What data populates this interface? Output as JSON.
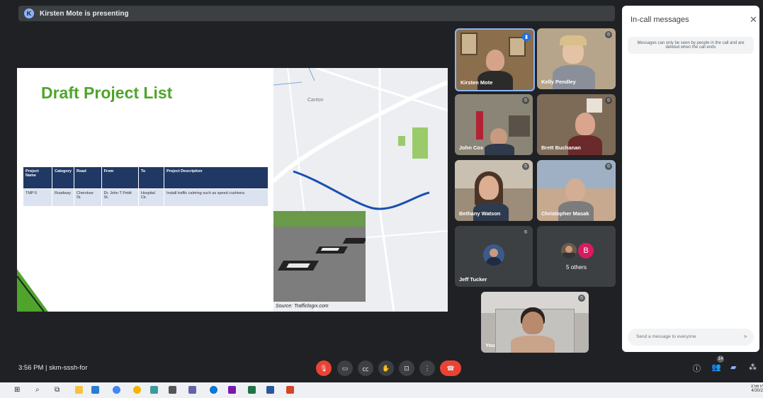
{
  "presenter": {
    "initial": "K",
    "text": "Kirsten Mote is presenting"
  },
  "slide": {
    "title": "Draft Project List",
    "table_headers": [
      "Project Name",
      "Category",
      "Road",
      "From",
      "To",
      "Project Description"
    ],
    "table_rows": [
      [
        "TMP 6",
        "Roadway",
        "Cherokee St.",
        "Dr. John T Pettit St.",
        "Hospital Cir.",
        "Install traffic calming such as speed cushions."
      ]
    ],
    "map_label": "Canton",
    "source": "Source: Trafficlogix.com"
  },
  "participants": [
    {
      "name": "Kirsten Mote",
      "mic": "speaking",
      "bg": "#8b6e4c"
    },
    {
      "name": "Kelly Pendley",
      "mic": "muted",
      "bg": "#b6a58a"
    },
    {
      "name": "John Cox",
      "mic": "muted",
      "bg": "#8a8576"
    },
    {
      "name": "Brett Buchanan",
      "mic": "muted",
      "bg": "#7d6b58"
    },
    {
      "name": "Bethany Watson",
      "mic": "muted",
      "bg": "#9c8c7a"
    },
    {
      "name": "Christopher Masak",
      "mic": "muted",
      "bg": "#9fb0c4"
    },
    {
      "name": "Jeff Tucker",
      "mic": "muted",
      "bg": "#3c4043"
    },
    {
      "name": "5 others",
      "mic": "",
      "bg": "#3c4043",
      "avatar_letter": "B"
    },
    {
      "name": "You",
      "mic": "muted",
      "bg": "#b8b5b0"
    }
  ],
  "chat": {
    "title": "In-call messages",
    "note": "Messages can only be seen by people in the call and are deleted when the call ends",
    "placeholder": "Send a message to everyone"
  },
  "meeting": {
    "time_code": "3:56 PM  |  skm-sssh-for",
    "people_count": "14"
  },
  "controls": [
    "mic-off-icon",
    "camera-icon",
    "captions-icon",
    "raise-hand-icon",
    "present-icon",
    "more-icon",
    "end-call-icon"
  ],
  "taskbar": {
    "clock_time": "3:56 P",
    "clock_date": "4/30/2"
  },
  "colors": {
    "accent_green": "#4fa52b",
    "table_header": "#1f3864",
    "end_call": "#ea4335",
    "bg": "#202124"
  }
}
